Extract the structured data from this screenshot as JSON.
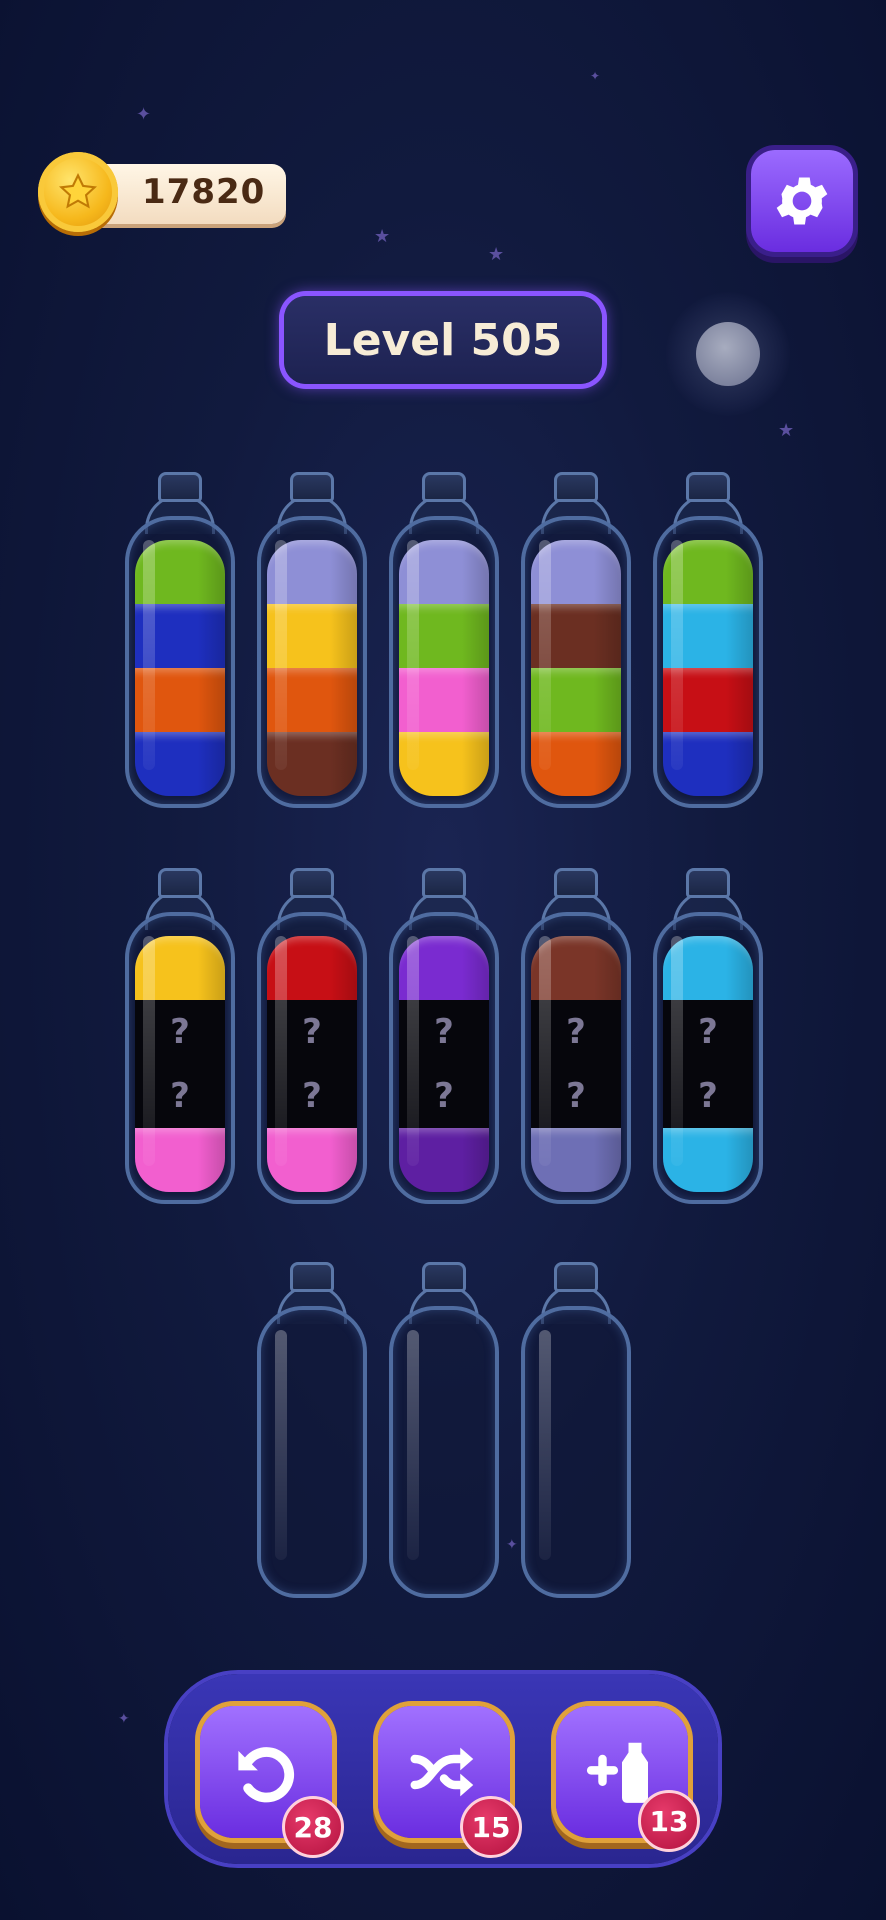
{
  "hud": {
    "coins": "17820",
    "level": "Level 505"
  },
  "colors": {
    "green": "#6fb81f",
    "blue": "#1e2fbf",
    "orange": "#e0560e",
    "lavender": "#8e8fd6",
    "yellow": "#f6c21c",
    "brown": "#6b2f22",
    "pink": "#f25fcf",
    "cyan": "#2bb3e6",
    "red": "#c70f15",
    "purple": "#7a2bd0",
    "dark_purple": "#5e1fa2",
    "slate": "#6e6fb5",
    "rust": "#7a3528",
    "hidden": "#06060c"
  },
  "bottles": [
    {
      "name": "bottle-1",
      "layers": [
        "blue",
        "orange",
        "blue",
        "green"
      ]
    },
    {
      "name": "bottle-2",
      "layers": [
        "brown",
        "orange",
        "yellow",
        "lavender"
      ]
    },
    {
      "name": "bottle-3",
      "layers": [
        "yellow",
        "pink",
        "green",
        "lavender"
      ]
    },
    {
      "name": "bottle-4",
      "layers": [
        "orange",
        "green",
        "brown",
        "lavender"
      ]
    },
    {
      "name": "bottle-5",
      "layers": [
        "blue",
        "red",
        "cyan",
        "green"
      ]
    },
    {
      "name": "bottle-6",
      "layers": [
        "pink",
        "?",
        "?",
        "yellow"
      ]
    },
    {
      "name": "bottle-7",
      "layers": [
        "pink",
        "?",
        "?",
        "red"
      ]
    },
    {
      "name": "bottle-8",
      "layers": [
        "dark_purple",
        "?",
        "?",
        "purple"
      ]
    },
    {
      "name": "bottle-9",
      "layers": [
        "slate",
        "?",
        "?",
        "rust"
      ]
    },
    {
      "name": "bottle-10",
      "layers": [
        "cyan",
        "?",
        "?",
        "cyan"
      ]
    },
    {
      "name": "bottle-11",
      "layers": []
    },
    {
      "name": "bottle-12",
      "layers": []
    },
    {
      "name": "bottle-13",
      "layers": []
    }
  ],
  "tools": {
    "undo_count": "28",
    "shuffle_count": "15",
    "add_bottle_count": "13"
  },
  "icons": {
    "coin": "star-coin-icon",
    "settings": "gear-icon",
    "undo": "undo-icon",
    "shuffle": "shuffle-icon",
    "add_bottle": "add-bottle-icon"
  }
}
